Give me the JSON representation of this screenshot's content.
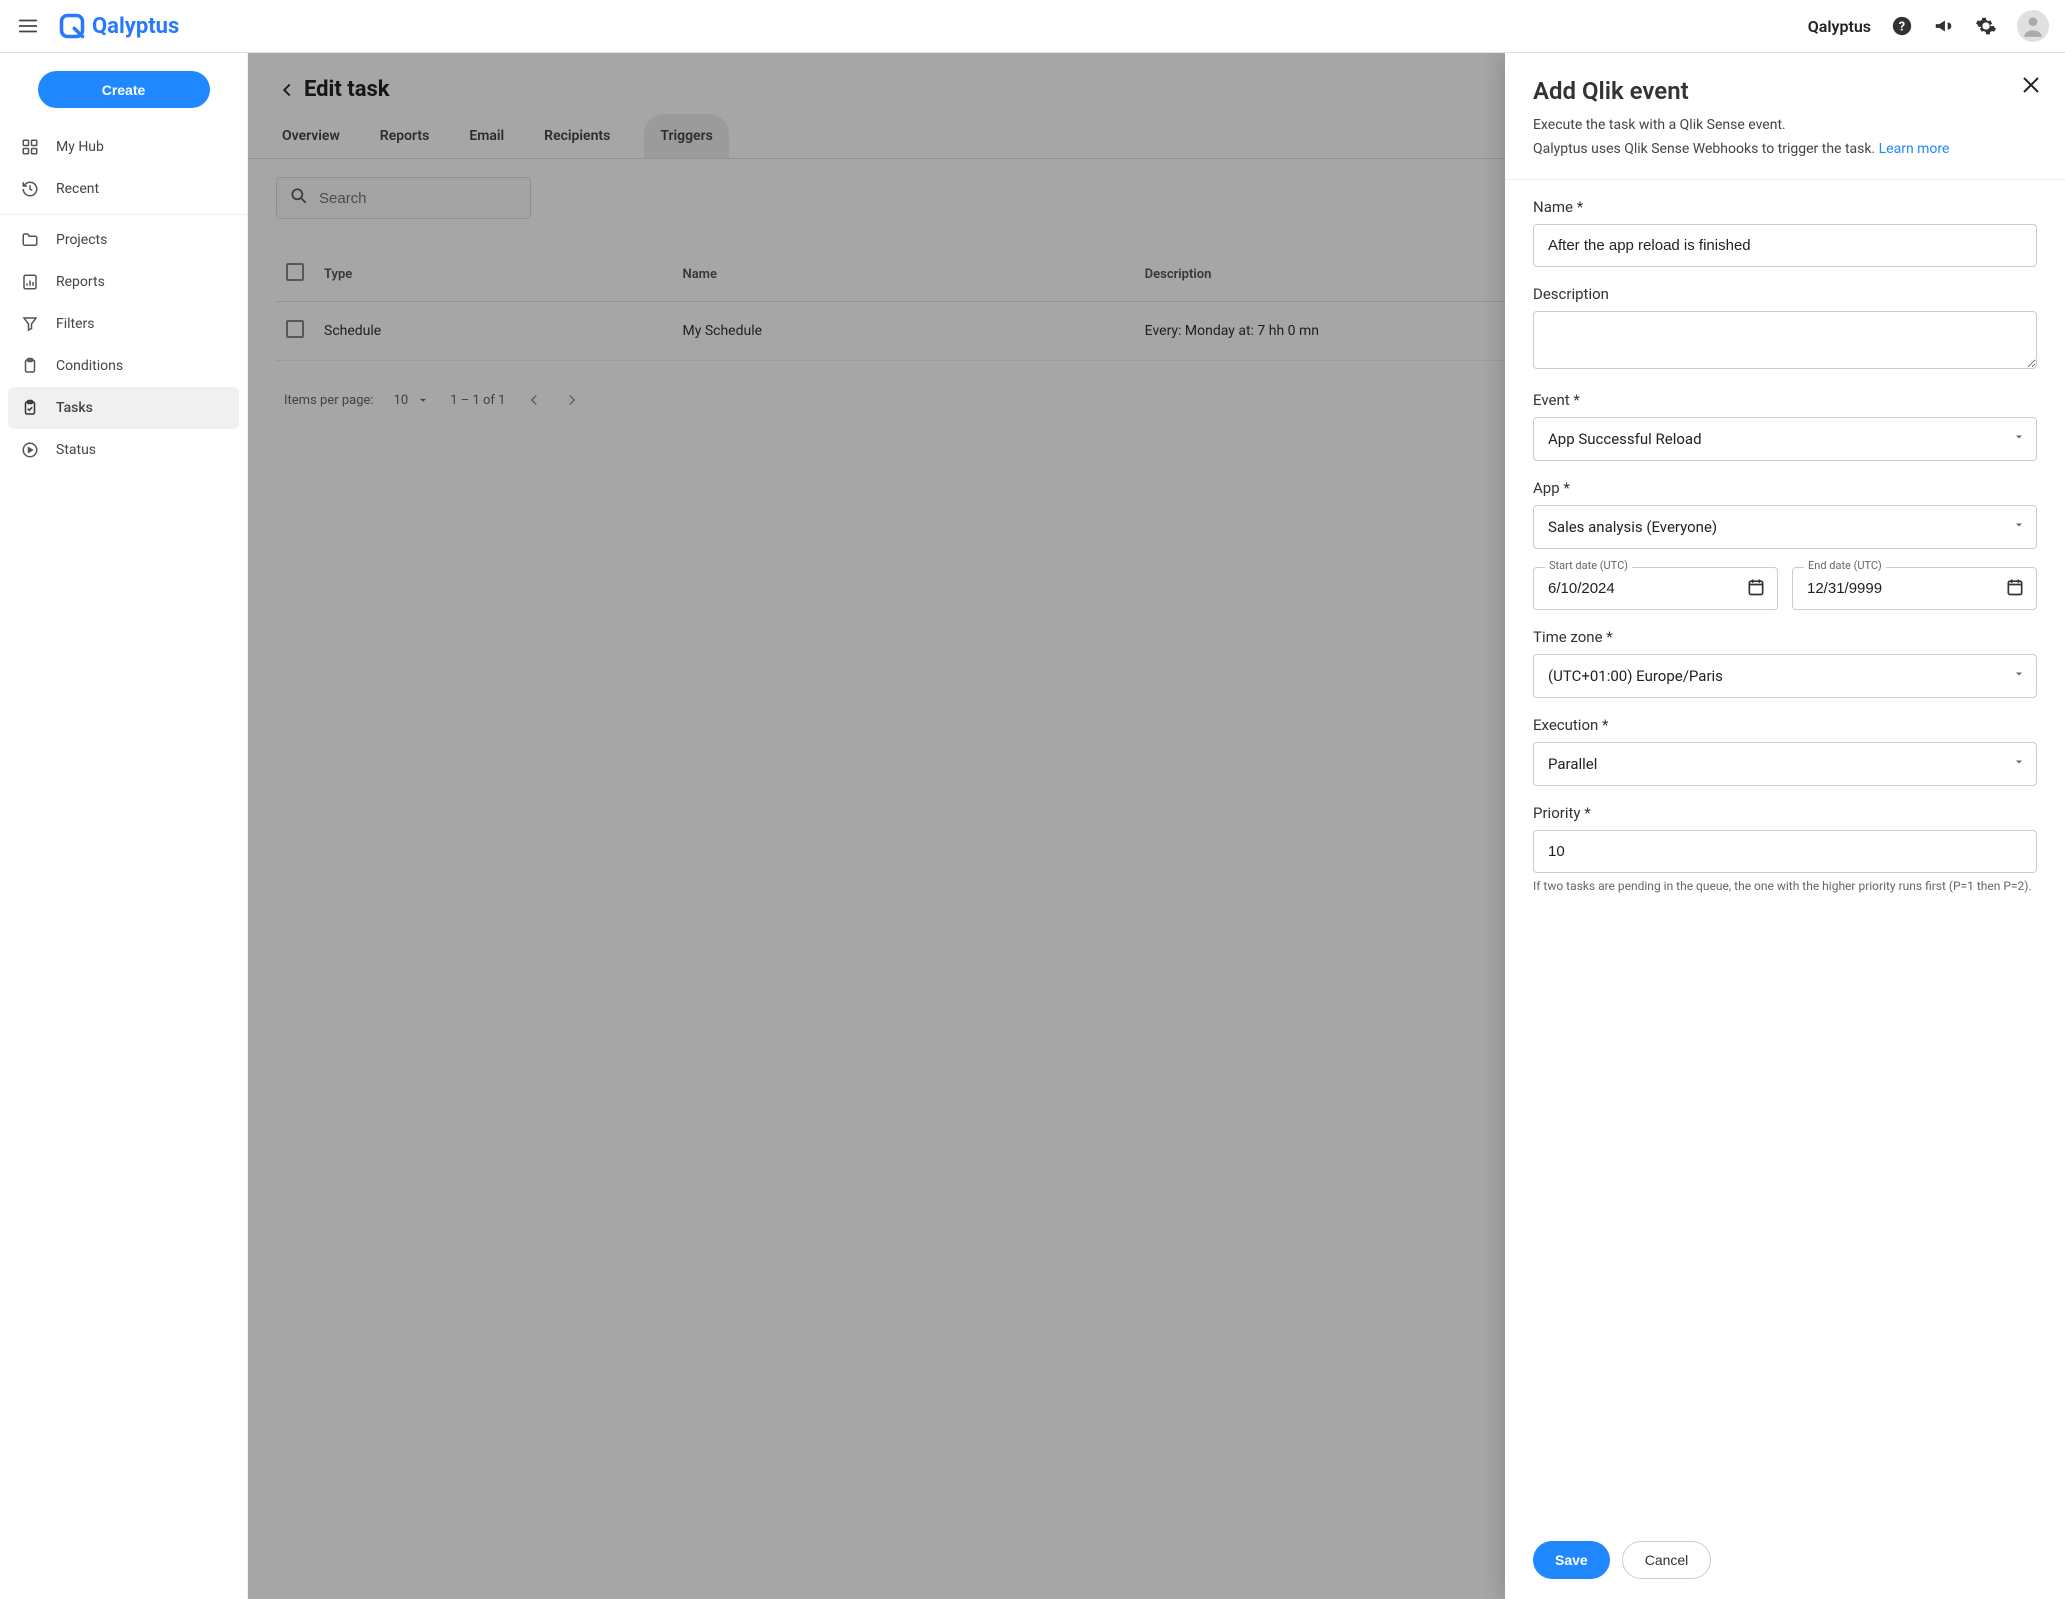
{
  "header": {
    "app_label": "Qalyptus",
    "logo_text": "Qalyptus"
  },
  "sidebar": {
    "create_label": "Create",
    "items": [
      {
        "label": "My Hub",
        "icon": "grid-icon"
      },
      {
        "label": "Recent",
        "icon": "history-icon"
      },
      {
        "label": "Projects",
        "icon": "folder-icon"
      },
      {
        "label": "Reports",
        "icon": "chart-icon"
      },
      {
        "label": "Filters",
        "icon": "filter-icon"
      },
      {
        "label": "Conditions",
        "icon": "clipboard-icon"
      },
      {
        "label": "Tasks",
        "icon": "task-icon"
      },
      {
        "label": "Status",
        "icon": "play-icon"
      }
    ]
  },
  "page": {
    "title": "Edit task",
    "tabs": [
      "Overview",
      "Reports",
      "Email",
      "Recipients",
      "Triggers"
    ],
    "search_placeholder": "Search",
    "table": {
      "columns": [
        "Type",
        "Name",
        "Description"
      ],
      "rows": [
        {
          "type": "Schedule",
          "name": "My Schedule",
          "description": "Every: Monday at: 7 hh 0 mn"
        }
      ]
    },
    "pagination": {
      "items_per_page_label": "Items per page:",
      "items_per_page_value": "10",
      "range": "1 – 1 of 1"
    }
  },
  "drawer": {
    "title": "Add Qlik event",
    "subtitle1": "Execute the task with a Qlik Sense event.",
    "subtitle2": "Qalyptus uses Qlik Sense Webhooks to trigger the task. ",
    "learn_more": "Learn more",
    "fields": {
      "name_label": "Name *",
      "name_value": "After the app reload is finished",
      "description_label": "Description",
      "description_value": "",
      "event_label": "Event *",
      "event_value": "App Successful Reload",
      "app_label": "App *",
      "app_value": "Sales analysis (Everyone)",
      "start_date_label": "Start date (UTC)",
      "start_date_value": "6/10/2024",
      "end_date_label": "End date (UTC)",
      "end_date_value": "12/31/9999",
      "timezone_label": "Time zone *",
      "timezone_value": "(UTC+01:00) Europe/Paris",
      "execution_label": "Execution *",
      "execution_value": "Parallel",
      "priority_label": "Priority *",
      "priority_value": "10",
      "priority_hint": "If two tasks are pending in the queue, the one with the higher priority runs first (P=1 then P=2)."
    },
    "save_label": "Save",
    "cancel_label": "Cancel"
  }
}
